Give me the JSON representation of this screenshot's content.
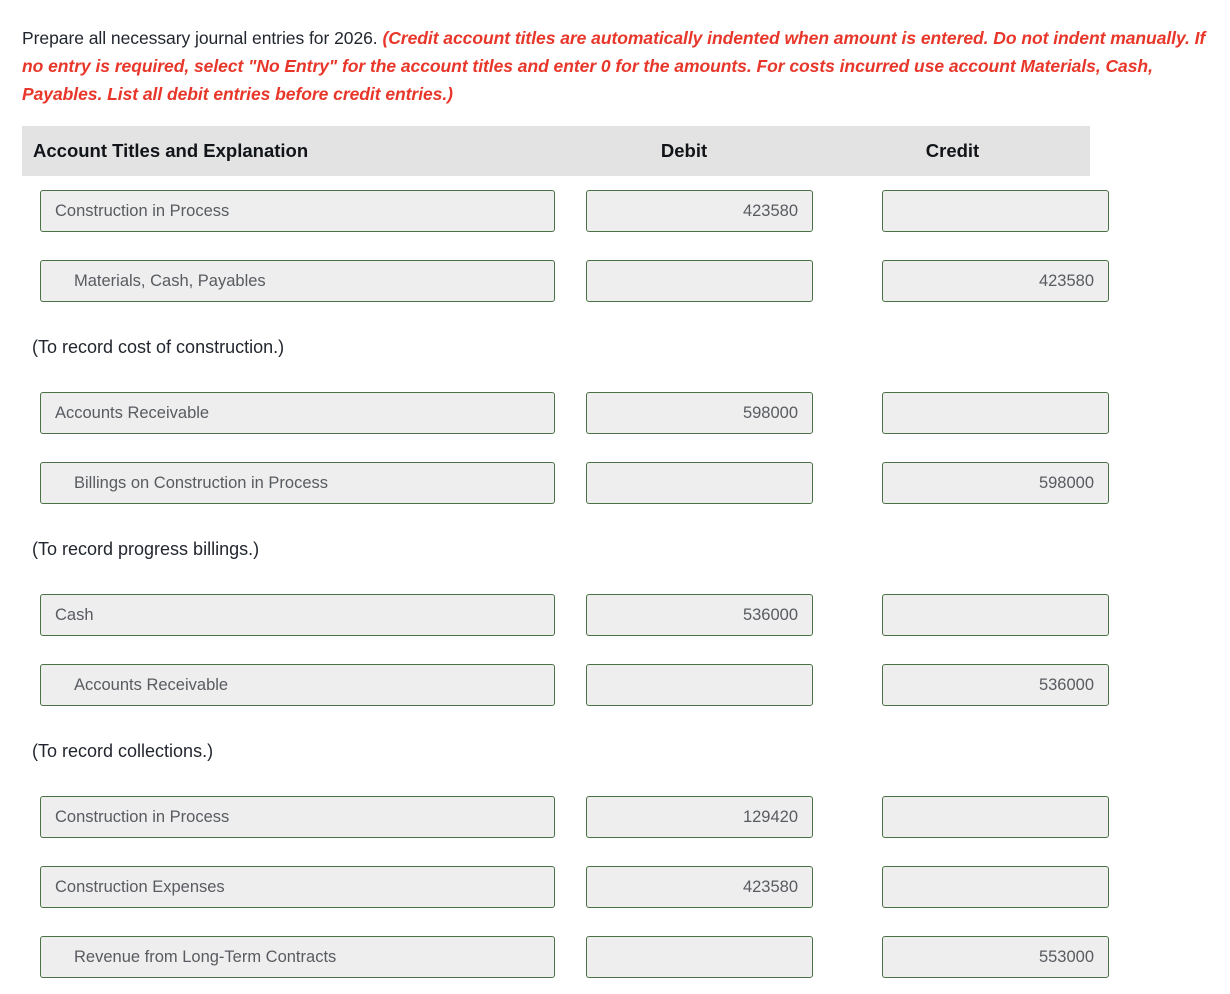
{
  "instruction": {
    "lead": "Prepare all necessary journal entries for 2026. ",
    "emphasis": "(Credit account titles are automatically indented when amount is entered. Do not indent manually. If no entry is required, select \"No Entry\" for the account titles and enter 0 for the amounts. For costs incurred use account Materials, Cash, Payables. List all debit entries before credit entries.)",
    "emphasis_color": "#e8372a"
  },
  "table": {
    "headers": {
      "account": "Account Titles and Explanation",
      "debit": "Debit",
      "credit": "Credit"
    },
    "header_background": "#e3e3e3",
    "field_border_color": "#4a7045",
    "field_background": "#eeeeee",
    "rows": [
      {
        "type": "entry",
        "account": "Construction in Process",
        "indent": false,
        "debit": "423580",
        "credit": ""
      },
      {
        "type": "entry",
        "account": "Materials, Cash, Payables",
        "indent": true,
        "debit": "",
        "credit": "423580"
      },
      {
        "type": "explanation",
        "text": "(To record cost of construction.)"
      },
      {
        "type": "entry",
        "account": "Accounts Receivable",
        "indent": false,
        "debit": "598000",
        "credit": ""
      },
      {
        "type": "entry",
        "account": "Billings on Construction in Process",
        "indent": true,
        "debit": "",
        "credit": "598000"
      },
      {
        "type": "explanation",
        "text": "(To record progress billings.)"
      },
      {
        "type": "entry",
        "account": "Cash",
        "indent": false,
        "debit": "536000",
        "credit": ""
      },
      {
        "type": "entry",
        "account": "Accounts Receivable",
        "indent": true,
        "debit": "",
        "credit": "536000"
      },
      {
        "type": "explanation",
        "text": "(To record collections.)"
      },
      {
        "type": "entry",
        "account": "Construction in Process",
        "indent": false,
        "debit": "129420",
        "credit": ""
      },
      {
        "type": "entry",
        "account": "Construction Expenses",
        "indent": false,
        "debit": "423580",
        "credit": ""
      },
      {
        "type": "entry",
        "account": "Revenue from Long-Term Contracts",
        "indent": true,
        "debit": "",
        "credit": "553000"
      }
    ]
  }
}
